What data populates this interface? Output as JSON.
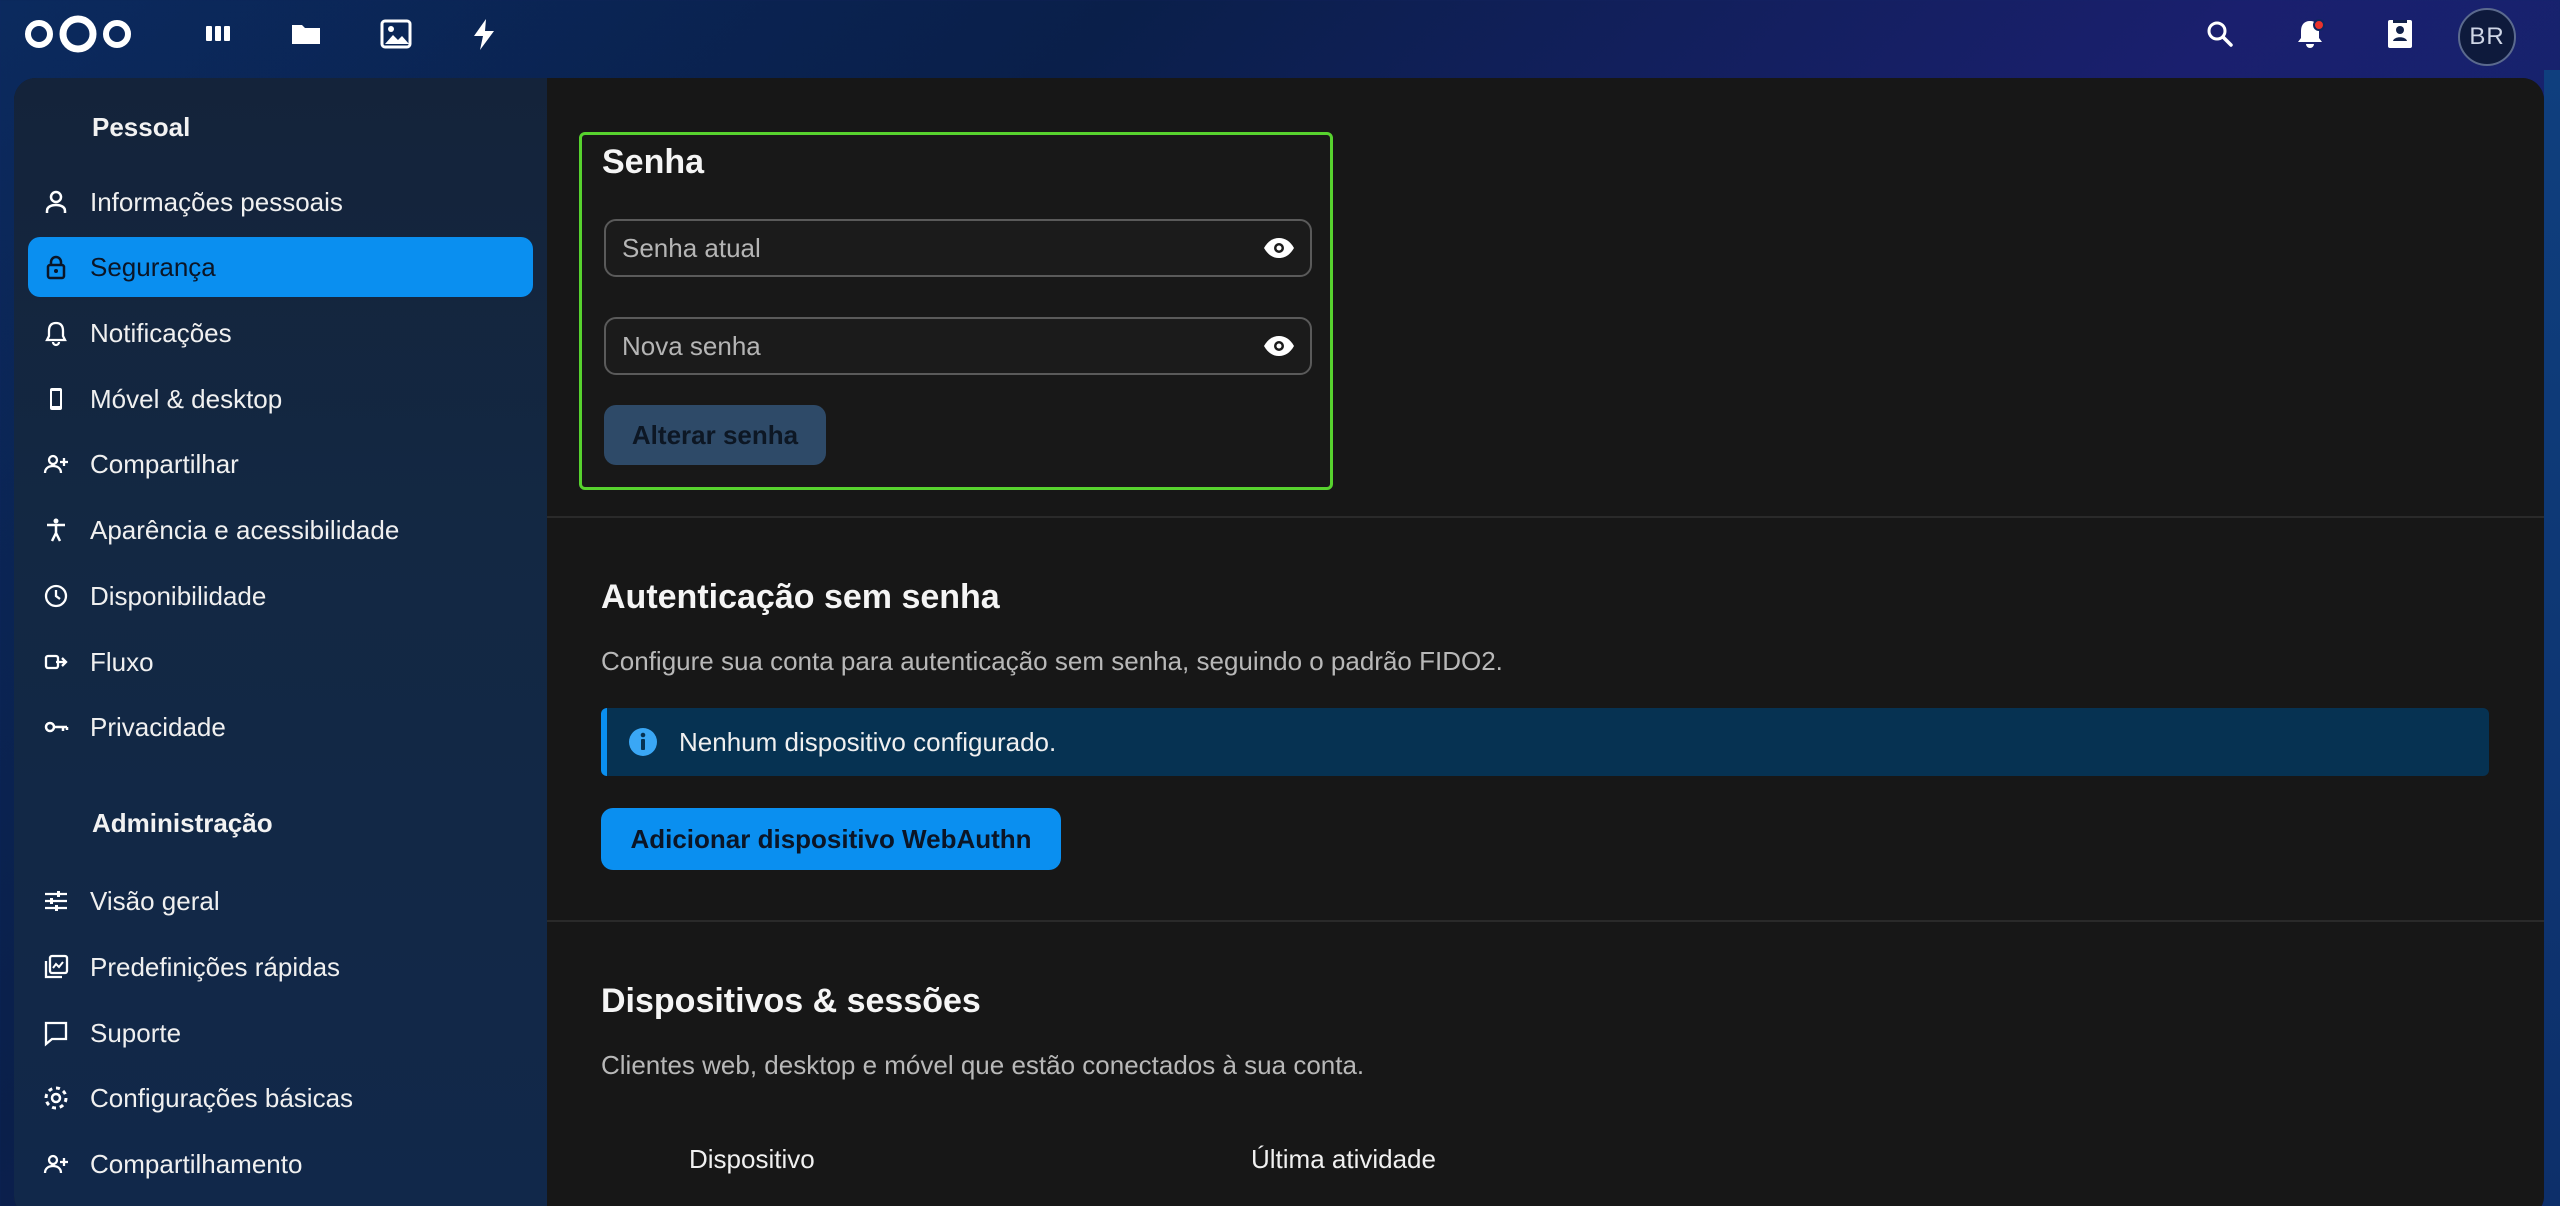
{
  "topbar": {
    "apps": [
      {
        "name": "dashboard-icon"
      },
      {
        "name": "files-icon"
      },
      {
        "name": "photos-icon"
      },
      {
        "name": "activity-icon"
      }
    ],
    "right": [
      {
        "name": "search-icon"
      },
      {
        "name": "notifications-icon"
      },
      {
        "name": "contacts-icon"
      }
    ],
    "avatar_initials": "BR"
  },
  "sidebar": {
    "personal_caption": "Pessoal",
    "personal_items": [
      {
        "label": "Informações pessoais",
        "icon": "user-icon"
      },
      {
        "label": "Segurança",
        "icon": "lock-icon",
        "active": true
      },
      {
        "label": "Notificações",
        "icon": "bell-icon"
      },
      {
        "label": "Móvel & desktop",
        "icon": "phone-icon"
      },
      {
        "label": "Compartilhar",
        "icon": "share-user-icon"
      },
      {
        "label": "Aparência e acessibilidade",
        "icon": "accessibility-icon"
      },
      {
        "label": "Disponibilidade",
        "icon": "clock-icon"
      },
      {
        "label": "Fluxo",
        "icon": "flow-icon"
      },
      {
        "label": "Privacidade",
        "icon": "key-icon"
      }
    ],
    "admin_caption": "Administração",
    "admin_items": [
      {
        "label": "Visão geral",
        "icon": "sliders-icon"
      },
      {
        "label": "Predefinições rápidas",
        "icon": "presets-icon"
      },
      {
        "label": "Suporte",
        "icon": "chat-icon"
      },
      {
        "label": "Configurações básicas",
        "icon": "gear-icon"
      },
      {
        "label": "Compartilhamento",
        "icon": "share-user-icon"
      }
    ]
  },
  "password": {
    "title": "Senha",
    "current_placeholder": "Senha atual",
    "new_placeholder": "Nova senha",
    "change_button": "Alterar senha"
  },
  "passwordless": {
    "title": "Autenticação sem senha",
    "description": "Configure sua conta para autenticação sem senha, seguindo o padrão FIDO2.",
    "info": "Nenhum dispositivo configurado.",
    "add_button": "Adicionar dispositivo WebAuthn"
  },
  "sessions": {
    "title": "Dispositivos & sessões",
    "description": "Clientes web, desktop e móvel que estão conectados à sua conta.",
    "col_device": "Dispositivo",
    "col_last_activity": "Última atividade"
  },
  "colors": {
    "accent": "#0a8ff0",
    "highlight_border": "#57d22e"
  }
}
